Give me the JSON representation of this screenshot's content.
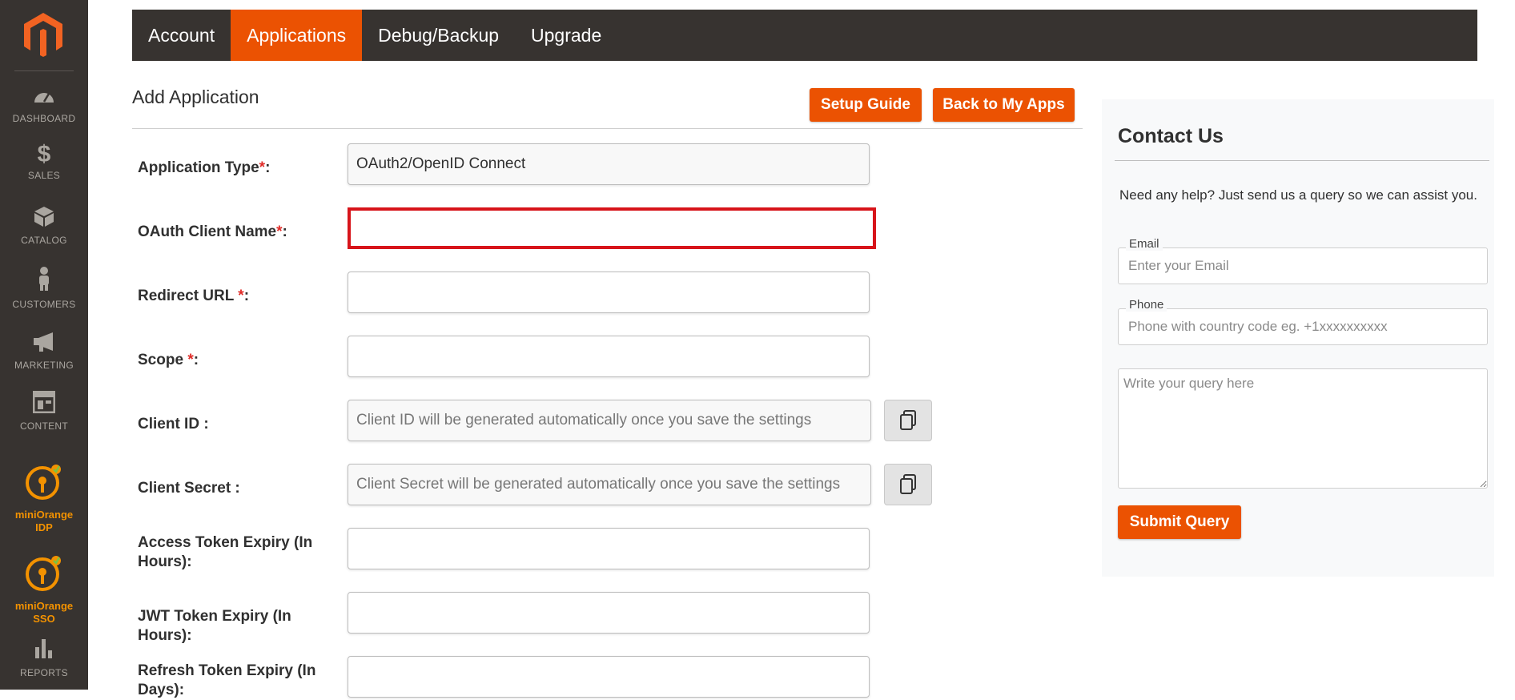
{
  "sidebar": {
    "items": [
      {
        "label": "DASHBOARD",
        "icon": "dashboard-gauge-icon"
      },
      {
        "label": "SALES",
        "icon": "dollar-icon"
      },
      {
        "label": "CATALOG",
        "icon": "box-icon"
      },
      {
        "label": "CUSTOMERS",
        "icon": "person-icon"
      },
      {
        "label": "MARKETING",
        "icon": "megaphone-icon"
      },
      {
        "label": "CONTENT",
        "icon": "layout-icon"
      },
      {
        "label_line1": "miniOrange",
        "label_line2": "IDP",
        "icon": "miniorange-key-icon"
      },
      {
        "label_line1": "miniOrange",
        "label_line2": "SSO",
        "icon": "miniorange-key-icon"
      },
      {
        "label": "REPORTS",
        "icon": "bar-chart-icon"
      }
    ]
  },
  "tabs": [
    {
      "label": "Account",
      "active": false
    },
    {
      "label": "Applications",
      "active": true
    },
    {
      "label": "Debug/Backup",
      "active": false
    },
    {
      "label": "Upgrade",
      "active": false
    }
  ],
  "page": {
    "title": "Add Application",
    "setup_guide": "Setup Guide",
    "back_to_apps": "Back to My Apps"
  },
  "form": {
    "app_type": {
      "label": "Application Type",
      "req": "*",
      "suffix": ":",
      "value": "OAuth2/OpenID Connect"
    },
    "client_name": {
      "label": "OAuth Client Name",
      "req": "*",
      "suffix": ":",
      "value": ""
    },
    "redirect_url": {
      "label": "Redirect URL ",
      "req": "*",
      "suffix": ":",
      "value": ""
    },
    "scope": {
      "label": "Scope ",
      "req": "*",
      "suffix": ":",
      "value": ""
    },
    "client_id": {
      "label": "Client ID :",
      "placeholder": "Client ID will be generated automatically once you save the settings"
    },
    "client_secret": {
      "label": "Client Secret :",
      "placeholder": "Client Secret will be generated automatically once you save the settings"
    },
    "access_token_expiry": {
      "label": "Access Token Expiry (In Hours):",
      "value": ""
    },
    "jwt_token_expiry": {
      "label": "JWT Token Expiry (In Hours):",
      "value": ""
    },
    "refresh_token_expiry": {
      "label": "Refresh Token Expiry (In Days):",
      "value": ""
    }
  },
  "contact": {
    "title": "Contact Us",
    "help": "Need any help? Just send us a query so we can assist you.",
    "email_label": "Email",
    "email_placeholder": "Enter your Email",
    "phone_label": "Phone",
    "phone_placeholder": "Phone with country code eg. +1xxxxxxxxxx",
    "query_placeholder": "Write your query here",
    "submit": "Submit Query"
  },
  "colors": {
    "accent": "#eb5202",
    "sidebar_bg": "#373330",
    "miniorange": "#f39200",
    "error_border": "#d7141a"
  }
}
